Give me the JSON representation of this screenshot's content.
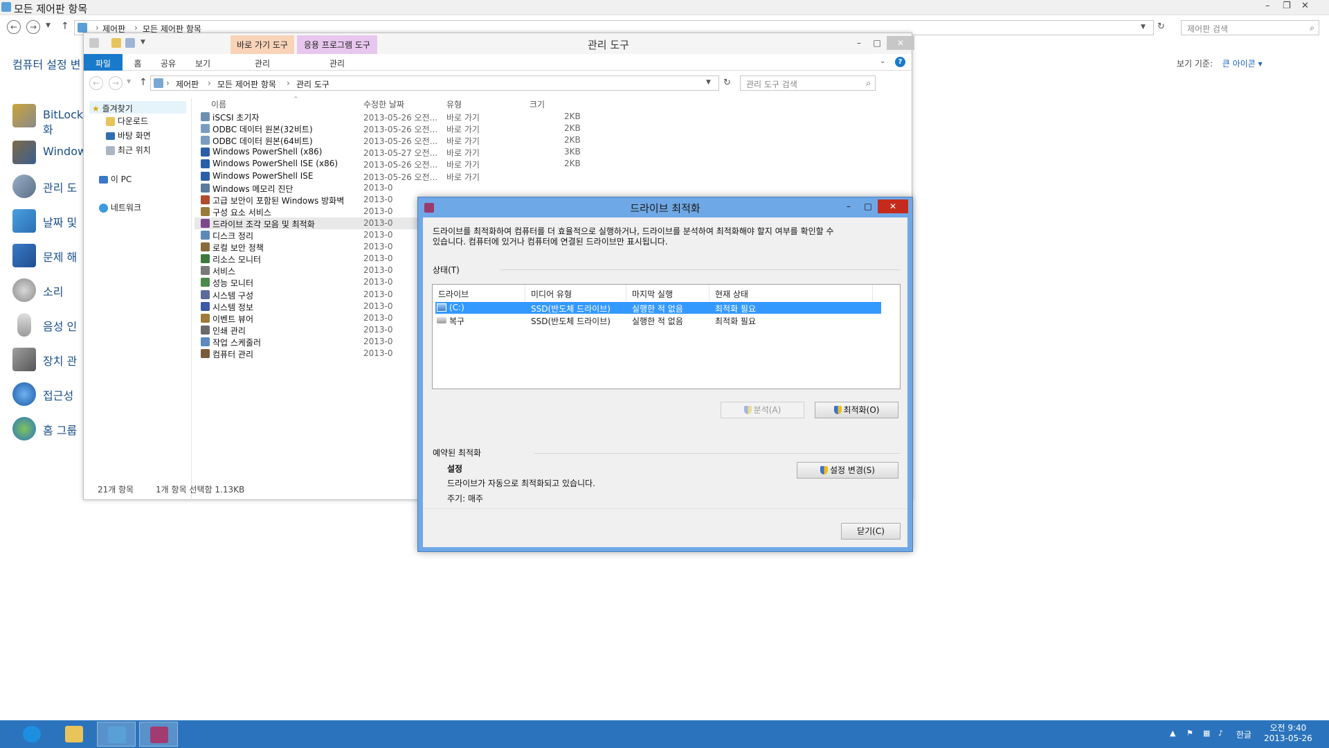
{
  "control_panel": {
    "title": "모든 제어판 항목",
    "breadcrumb": [
      "제어판",
      "모든 제어판 항목"
    ],
    "search_placeholder": "제어판 검색",
    "heading": "컴퓨터 설정 변",
    "view_label": "보기 기준:",
    "view_value": "큰 아이콘 ▾",
    "items": [
      {
        "label": "BitLocke",
        "label2": "화",
        "icon": "bitlocker-icon"
      },
      {
        "label": "Window",
        "icon": "windows-firewall-icon"
      },
      {
        "label": "관리 도",
        "icon": "admin-tools-icon"
      },
      {
        "label": "날짜 및",
        "icon": "date-time-icon"
      },
      {
        "label": "문제 해",
        "icon": "troubleshooting-icon"
      },
      {
        "label": "소리",
        "icon": "sound-icon"
      },
      {
        "label": "음성 인",
        "icon": "speech-recognition-icon"
      },
      {
        "label": "장치 관",
        "icon": "device-manager-icon"
      },
      {
        "label": "접근성",
        "icon": "ease-of-access-icon"
      },
      {
        "label": "홈 그룹",
        "icon": "homegroup-icon"
      }
    ]
  },
  "explorer": {
    "title": "관리 도구",
    "context_tabs": [
      {
        "label": "바로 가기 도구",
        "color": "#f9d3b8"
      },
      {
        "label": "응용 프로그램 도구",
        "color": "#e8c7ef"
      }
    ],
    "ribbon_tabs": [
      "파일",
      "홈",
      "공유",
      "보기"
    ],
    "context_subtabs": [
      "관리",
      "관리"
    ],
    "breadcrumb": [
      "제어판",
      "모든 제어판 항목",
      "관리 도구"
    ],
    "search_placeholder": "관리 도구 검색",
    "nav": {
      "favorites": "즐겨찾기",
      "items": [
        "다운로드",
        "바탕 화면",
        "최근 위치"
      ],
      "this_pc": "이 PC",
      "network": "네트워크"
    },
    "columns": [
      "이름",
      "수정한 날짜",
      "유형",
      "크기"
    ],
    "files": [
      {
        "name": "iSCSI 초기자",
        "date": "2013-05-26 오전...",
        "type": "바로 가기",
        "size": "2KB"
      },
      {
        "name": "ODBC 데이터 원본(32비트)",
        "date": "2013-05-26 오전...",
        "type": "바로 가기",
        "size": "2KB"
      },
      {
        "name": "ODBC 데이터 원본(64비트)",
        "date": "2013-05-26 오전...",
        "type": "바로 가기",
        "size": "2KB"
      },
      {
        "name": "Windows PowerShell (x86)",
        "date": "2013-05-27 오전...",
        "type": "바로 가기",
        "size": "3KB"
      },
      {
        "name": "Windows PowerShell ISE (x86)",
        "date": "2013-05-26 오전...",
        "type": "바로 가기",
        "size": "2KB"
      },
      {
        "name": "Windows PowerShell ISE",
        "date": "2013-05-26 오전...",
        "type": "바로 가기",
        "size": ""
      },
      {
        "name": "Windows 메모리 진단",
        "date": "2013-0",
        "type": "",
        "size": ""
      },
      {
        "name": "고급 보안이 포함된 Windows 방화벽",
        "date": "2013-0",
        "type": "",
        "size": ""
      },
      {
        "name": "구성 요소 서비스",
        "date": "2013-0",
        "type": "",
        "size": ""
      },
      {
        "name": "드라이브 조각 모음 및 최적화",
        "date": "2013-0",
        "type": "",
        "size": ""
      },
      {
        "name": "디스크 정리",
        "date": "2013-0",
        "type": "",
        "size": ""
      },
      {
        "name": "로컬 보안 정책",
        "date": "2013-0",
        "type": "",
        "size": ""
      },
      {
        "name": "리소스 모니터",
        "date": "2013-0",
        "type": "",
        "size": ""
      },
      {
        "name": "서비스",
        "date": "2013-0",
        "type": "",
        "size": ""
      },
      {
        "name": "성능 모니터",
        "date": "2013-0",
        "type": "",
        "size": ""
      },
      {
        "name": "시스템 구성",
        "date": "2013-0",
        "type": "",
        "size": ""
      },
      {
        "name": "시스템 정보",
        "date": "2013-0",
        "type": "",
        "size": ""
      },
      {
        "name": "이벤트 뷰어",
        "date": "2013-0",
        "type": "",
        "size": ""
      },
      {
        "name": "인쇄 관리",
        "date": "2013-0",
        "type": "",
        "size": ""
      },
      {
        "name": "작업 스케줄러",
        "date": "2013-0",
        "type": "",
        "size": ""
      },
      {
        "name": "컴퓨터 관리",
        "date": "2013-0",
        "type": "",
        "size": ""
      }
    ],
    "status_count": "21개 항목",
    "status_selected": "1개 항목 선택함 1.13KB"
  },
  "dialog": {
    "title": "드라이브 최적화",
    "description_line1": "드라이브를 최적화하여 컴퓨터를 더 효율적으로 실행하거나, 드라이브를 분석하여 최적화해야 할지 여부를 확인할 수",
    "description_line2": "있습니다. 컴퓨터에 있거나 컴퓨터에 연결된 드라이브만 표시됩니다.",
    "status_label": "상태(T)",
    "columns": [
      "드라이브",
      "미디어 유형",
      "마지막 실행",
      "현재 상태"
    ],
    "drives": [
      {
        "drive": "(C:)",
        "media": "SSD(반도체 드라이브)",
        "last_run": "실행한 적 없음",
        "status": "최적화 필요"
      },
      {
        "drive": "복구",
        "media": "SSD(반도체 드라이브)",
        "last_run": "실행한 적 없음",
        "status": "최적화 필요"
      }
    ],
    "analyze_button": "분석(A)",
    "optimize_button": "최적화(O)",
    "scheduled_label": "예약된 최적화",
    "settings_heading": "설정",
    "settings_text": "드라이브가 자동으로 최적화되고 있습니다.",
    "frequency": "주기: 매주",
    "change_settings_button": "설정 변경(S)",
    "close_button": "닫기(C)"
  },
  "taskbar": {
    "apps": [
      {
        "name": "internet-explorer-icon",
        "color": "#1e8fe0"
      },
      {
        "name": "file-explorer-icon",
        "color": "#e8c45a"
      },
      {
        "name": "control-panel-icon",
        "color": "#5aa0d8"
      },
      {
        "name": "drive-optimizer-icon",
        "color": "#a23b72"
      }
    ],
    "language": "한글",
    "time": "오전 9:40",
    "date": "2013-05-26"
  }
}
